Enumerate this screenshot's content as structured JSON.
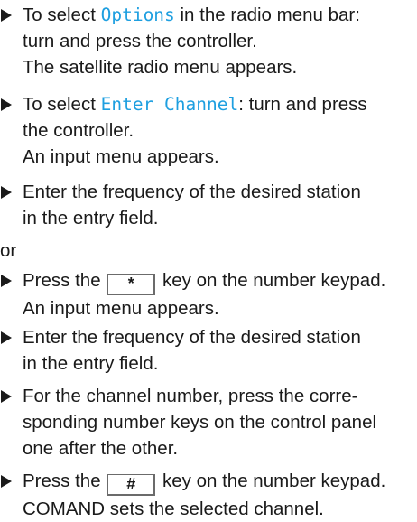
{
  "steps": [
    {
      "pre": "To select ",
      "highlight": "Options",
      "post": " in the radio menu bar:",
      "line2": "turn and press the controller.",
      "result": "The satellite radio menu appears."
    },
    {
      "pre": "To select ",
      "highlight": "Enter Channel",
      "post": ": turn and press",
      "line2": "the controller.",
      "result": "An input menu appears."
    },
    {
      "line1": "Enter the frequency of the desired station",
      "line2": "in the entry field."
    }
  ],
  "or_text": "or",
  "alt_steps": [
    {
      "pre": "Press the",
      "key": "*",
      "post": "key on the number keypad.",
      "result": "An input menu appears."
    },
    {
      "line1": "Enter the frequency of the desired station",
      "line2": "in the entry field."
    },
    {
      "line1": "For the channel number, press the corre-",
      "line2": "sponding number keys on the control panel",
      "line3": "one after the other."
    },
    {
      "pre": "Press the",
      "key": "#",
      "post": "key on the number keypad.",
      "result": "COMAND sets the selected channel."
    }
  ],
  "icons": {
    "bullet": "triangle-right-icon"
  }
}
